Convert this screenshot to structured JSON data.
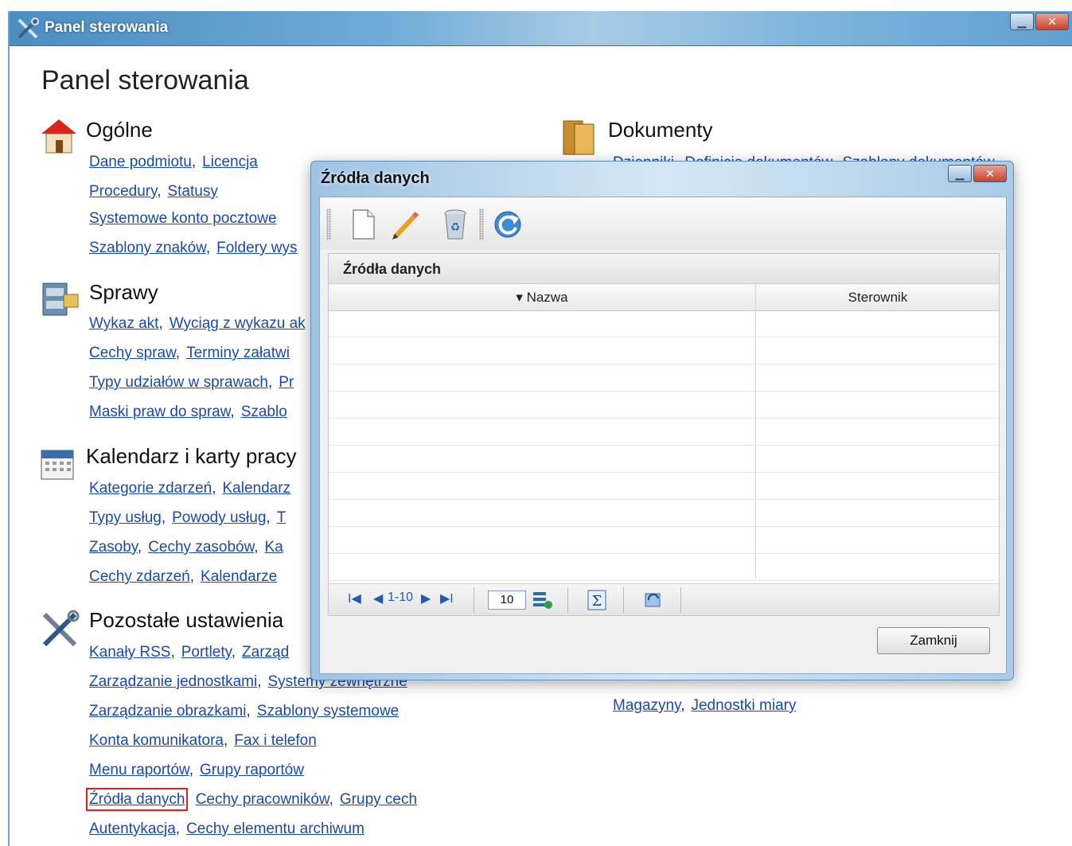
{
  "window": {
    "title": "Panel sterowania",
    "min_label": "▁",
    "close_label": "✕"
  },
  "page": {
    "title": "Panel sterowania"
  },
  "sections": {
    "ogolne": {
      "title": "Ogólne",
      "lines": [
        [
          "Dane podmiotu",
          "Licencja"
        ],
        [
          "Procedury",
          "Statusy"
        ],
        [
          "Systemowe konto pocztowe"
        ],
        [
          "Szablony znaków",
          "Foldery wys"
        ]
      ]
    },
    "sprawy": {
      "title": "Sprawy",
      "lines": [
        [
          "Wykaz akt",
          "Wyciąg z wykazu ak"
        ],
        [
          "Cechy spraw",
          "Terminy załatwi"
        ],
        [
          "Typy udziałów w sprawach",
          "Pr"
        ],
        [
          "Maski praw do spraw",
          "Szablo"
        ]
      ]
    },
    "kalendarz": {
      "title": "Kalendarz i karty pracy",
      "lines": [
        [
          "Kategorie zdarzeń",
          "Kalendarz"
        ],
        [
          "Typy usług",
          "Powody usług",
          "T"
        ],
        [
          "Zasoby",
          "Cechy zasobów",
          "Ka"
        ],
        [
          "Cechy zdarzeń",
          "Kalendarze"
        ]
      ]
    },
    "pozostale": {
      "title": "Pozostałe ustawienia",
      "lines": [
        [
          "Kanały RSS",
          "Portlety",
          "Zarząd"
        ],
        [
          "Zarządzanie jednostkami",
          "Systemy zewnętrzne"
        ],
        [
          "Zarządzanie obrazkami",
          "Szablony systemowe"
        ],
        [
          "Konta komunikatora",
          "Fax i telefon"
        ],
        [
          "Menu raportów",
          "Grupy raportów"
        ],
        [
          "Źródła danych",
          "Cechy pracowników",
          "Grupy cech"
        ],
        [
          "Autentykacja",
          "Cechy elementu archiwum"
        ]
      ]
    },
    "dokumenty": {
      "title": "Dokumenty",
      "lines": [
        [
          "Dzienniki",
          "Definicje dokumentów",
          "Szablony dokumentów"
        ]
      ],
      "bottom_line": [
        "Magazyny",
        "Jednostki miary"
      ]
    }
  },
  "separator": ",",
  "dialog": {
    "title": "Źródła danych",
    "grid_caption": "Źródła danych",
    "columns": [
      "▾ Nazwa",
      "Sterownik"
    ],
    "pager": {
      "first": "I◀",
      "prev": "◀",
      "range": "1-10",
      "next": "▶",
      "last": "▶I",
      "page_size": "10"
    },
    "close_button": "Zamknij",
    "min_label": "▁",
    "close_label": "✕"
  }
}
